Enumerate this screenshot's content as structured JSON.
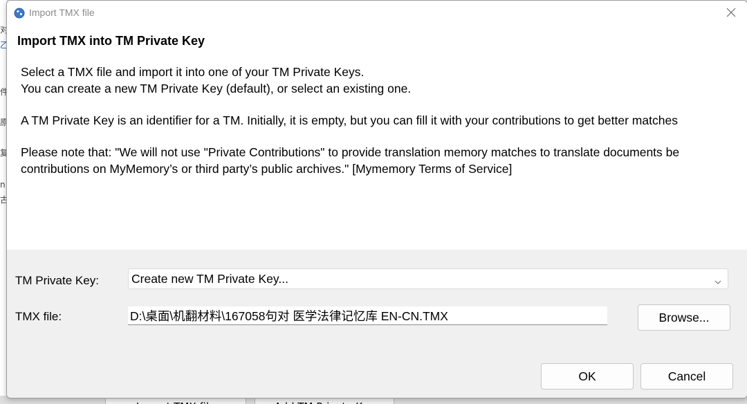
{
  "background": {
    "side_chars": [
      "对",
      "乙",
      "件",
      "原",
      "复",
      "n",
      "古"
    ],
    "buttons": [
      "Import TMX file",
      "Add TM Private Key"
    ]
  },
  "dialog": {
    "title": "Import TMX file",
    "heading": "Import TMX into TM Private Key",
    "paragraphs": [
      "Select a TMX file and import it into one of your TM Private Keys.",
      "You can create a new TM Private Key (default), or select an existing one.",
      "A TM Private Key is an identifier for a TM. Initially, it is empty, but you can fill it with your contributions to get better matches",
      "Please note that: \"We will not use \"Private Contributions\" to provide translation memory matches to translate documents be",
      "contributions on MyMemory’s or third party’s public archives.\" [Mymemory Terms of Service]"
    ],
    "tm_key_label": "TM Private Key:",
    "tm_key_value": "Create new TM Private Key...",
    "tmx_file_label": "TMX file:",
    "tmx_file_value": "D:\\桌面\\机翻材料\\167058句对 医学法律记忆库 EN-CN.TMX",
    "browse_label": "Browse...",
    "ok_label": "OK",
    "cancel_label": "Cancel"
  },
  "icons": {
    "app": "globe-icon",
    "close": "close-icon",
    "dropdown": "chevron-down-icon"
  },
  "colors": {
    "focus_border": "#5b8fd1",
    "title_text": "#8a8a8a"
  }
}
